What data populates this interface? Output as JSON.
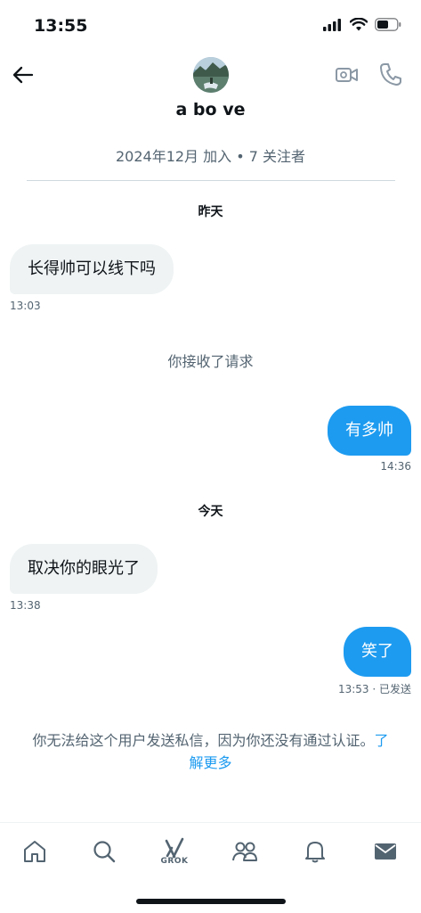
{
  "status_bar": {
    "time": "13:55"
  },
  "header": {
    "name": "a bo ve",
    "join_info": "2024年12月 加入 • 7 关注者"
  },
  "conversation": {
    "day1": "昨天",
    "msg1": {
      "text": "长得帅可以线下吗",
      "time": "13:03"
    },
    "system_msg": "你接收了请求",
    "msg2": {
      "text": "有多帅",
      "time": "14:36"
    },
    "day2": "今天",
    "msg3": {
      "text": "取决你的眼光了",
      "time": "13:38"
    },
    "msg4": {
      "text": "笑了",
      "time": "13:53 · 已发送"
    }
  },
  "notice": {
    "line1_text": "你无法给这个用户发送私信，因为你还没有通过认证。",
    "line1_link": "了",
    "line2_link": "解更多"
  },
  "tabbar": {
    "grok_label": "GROK",
    "items": [
      "home-icon",
      "search-icon",
      "grok-icon",
      "communities-icon",
      "notifications-icon",
      "messages-icon"
    ]
  },
  "colors": {
    "accent": "#1d9bf0",
    "muted": "#536471",
    "bubble_in": "#eff3f4"
  }
}
